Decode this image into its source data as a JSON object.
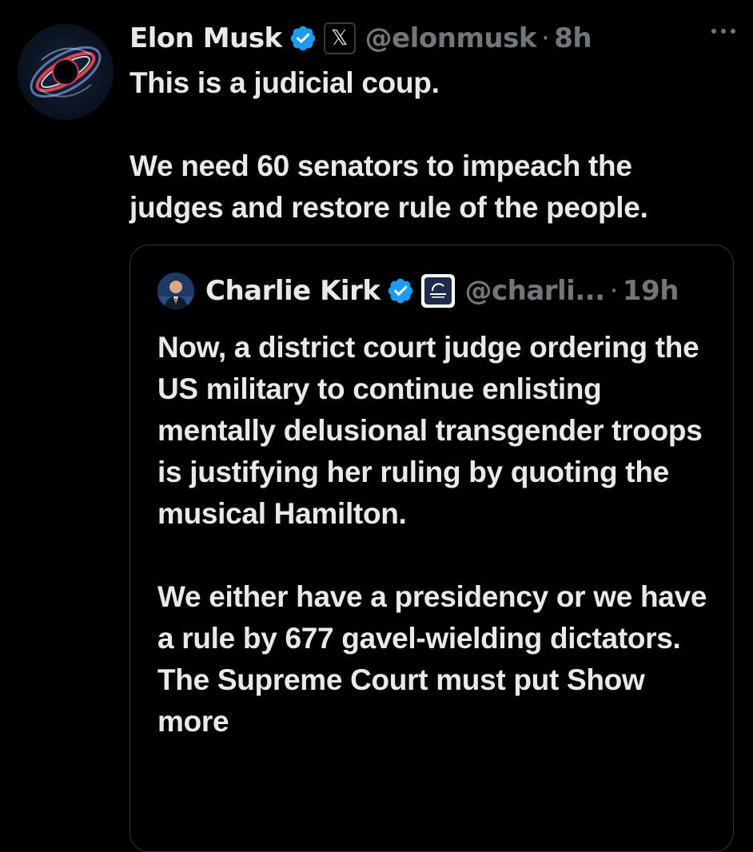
{
  "tweet": {
    "author_name": "Elon Musk",
    "handle": "@elonmusk",
    "separator": "·",
    "time": "8h",
    "affiliate_badge_glyph": "𝕏",
    "paragraphs": [
      "This is a judicial coup.",
      "We need 60 senators to impeach the judges and restore rule of the people."
    ],
    "icons": {
      "verified": "verified-badge-icon",
      "affiliate": "x-logo-icon",
      "more": "more-options-icon"
    }
  },
  "quote": {
    "author_name": "Charlie Kirk",
    "handle": "@charli...",
    "separator": "·",
    "time": "19h",
    "paragraphs": [
      "Now, a district court judge ordering the US military to continue enlisting mentally delusional transgender troops is justifying her ruling by quoting the musical Hamilton.",
      "We either have a presidency or we have a rule by 677 gavel-wielding dictators. The Supreme Court must put Show more"
    ]
  },
  "colors": {
    "background": "#000000",
    "text_primary": "#e7e9ea",
    "text_secondary": "#71767b",
    "verified_blue": "#1d9bf0",
    "border": "#2f3336"
  }
}
